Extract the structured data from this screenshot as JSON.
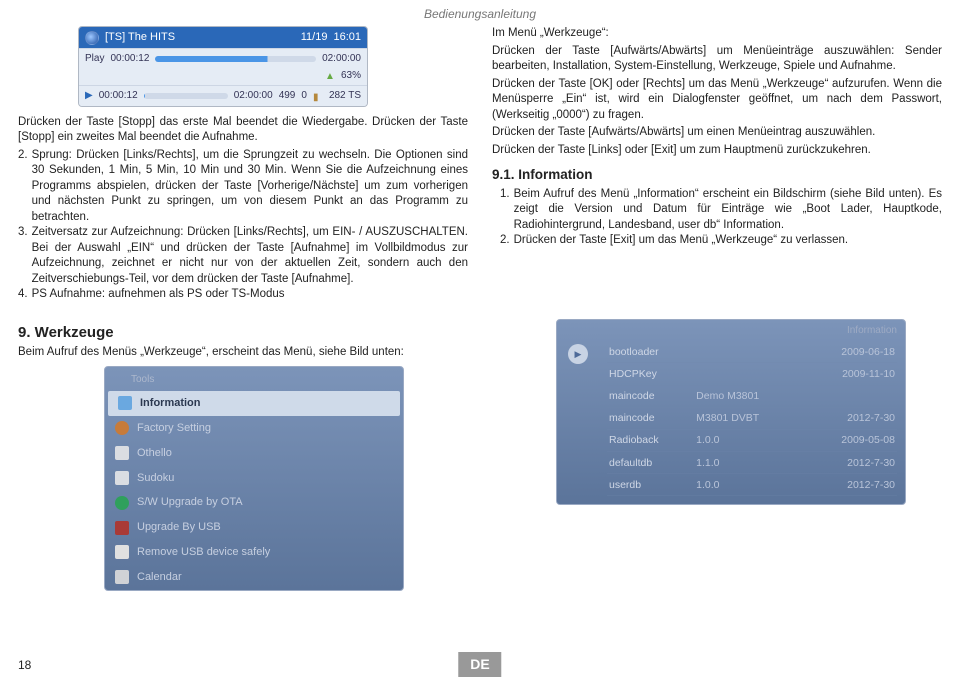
{
  "header": "Bedienungsanleitung",
  "player": {
    "title": "[TS] The HITS",
    "counter": "11/19",
    "clock": "16:01",
    "play_label": "Play",
    "play_start": "00:00:12",
    "play_end": "02:00:00",
    "percent": "63%",
    "b_start": "00:00:12",
    "b_mid": "02:00:00",
    "b_count": "499",
    "b_last": "0",
    "b_size": "282 TS"
  },
  "left": {
    "p1": "Drücken der Taste [Stopp] das erste Mal beendet die Wiedergabe. Drücken der Taste [Stopp] ein zweites Mal beendet die Aufnahme.",
    "i2n": "2.",
    "i2": "Sprung: Drücken [Links/Rechts], um die Sprungzeit zu wechseln. Die Optionen sind 30 Sekunden, 1 Min, 5 Min, 10 Min und 30 Min. Wenn Sie die Aufzeichnung eines Programms abspielen, drücken der Taste [Vorherige/Nächste] um zum vorherigen und nächsten Punkt zu springen, um von diesem Punkt an das Programm zu betrachten.",
    "i3n": "3.",
    "i3": "Zeitversatz zur Aufzeichnung: Drücken [Links/Rechts], um EIN- / AUSZUSCHALTEN. Bei der Auswahl „EIN“ und drücken der Taste [Aufnahme] im Vollbildmodus zur Aufzeichnung, zeichnet er nicht nur von der aktuellen Zeit, sondern auch den Zeitverschiebungs-Teil, vor dem drücken der Taste [Aufnahme].",
    "i4n": "4.",
    "i4": "PS Aufnahme: aufnehmen als PS oder TS-Modus"
  },
  "right": {
    "p1": "Im Menü „Werkzeuge“:",
    "p2": "Drücken der Taste [Aufwärts/Abwärts] um Menüeinträge auszuwählen: Sender bearbeiten, Installation, System-Einstellung, Werkzeuge, Spiele und Aufnahme.",
    "p3": "Drücken der Taste [OK] oder [Rechts] um das Menü „Werkzeuge“ aufzurufen. Wenn die Menüsperre „Ein“ ist, wird ein Dialogfenster geöffnet, um nach dem Passwort, (Werkseitig „0000“) zu fragen.",
    "p4": "Drücken der Taste [Aufwärts/Abwärts] um einen Menüeintrag auszuwählen.",
    "p5": "Drücken der Taste [Links] oder [Exit] um zum Hauptmenü zurückzukehren.",
    "h91": "9.1. Information",
    "i1n": "1.",
    "i1": "Beim Aufruf des Menü „Information“ erscheint ein Bildschirm (siehe Bild unten). Es zeigt die Version und Datum für Einträge wie „Boot Lader, Hauptkode, Radiohintergrund, Landesband, user db“ Information.",
    "i2n": "2.",
    "i2": "Drücken der Taste [Exit] um das Menü „Werkzeuge“ zu verlassen."
  },
  "werkzeuge": {
    "heading": "9. Werkzeuge",
    "intro": "Beim Aufruf des Menüs „Werkzeuge“, erscheint das Menü, siehe Bild unten:"
  },
  "tools_menu": {
    "title": "Tools",
    "items": [
      "Information",
      "Factory Setting",
      "Othello",
      "Sudoku",
      "S/W Upgrade by OTA",
      "Upgrade By USB",
      "Remove USB device safely",
      "Calendar"
    ]
  },
  "info_panel": {
    "title": "Information",
    "rows": [
      {
        "name": "bootloader",
        "val": "",
        "date": "2009-06-18"
      },
      {
        "name": "HDCPKey",
        "val": "",
        "date": "2009-11-10"
      },
      {
        "name": "maincode",
        "val": "Demo M3801",
        "date": ""
      },
      {
        "name": "maincode",
        "val": "M3801 DVBT",
        "date": "2012-7-30"
      },
      {
        "name": "Radioback",
        "val": "1.0.0",
        "date": "2009-05-08"
      },
      {
        "name": "defaultdb",
        "val": "1.1.0",
        "date": "2012-7-30"
      },
      {
        "name": "userdb",
        "val": "1.0.0",
        "date": "2012-7-30"
      }
    ]
  },
  "page_number": "18",
  "lang": "DE"
}
